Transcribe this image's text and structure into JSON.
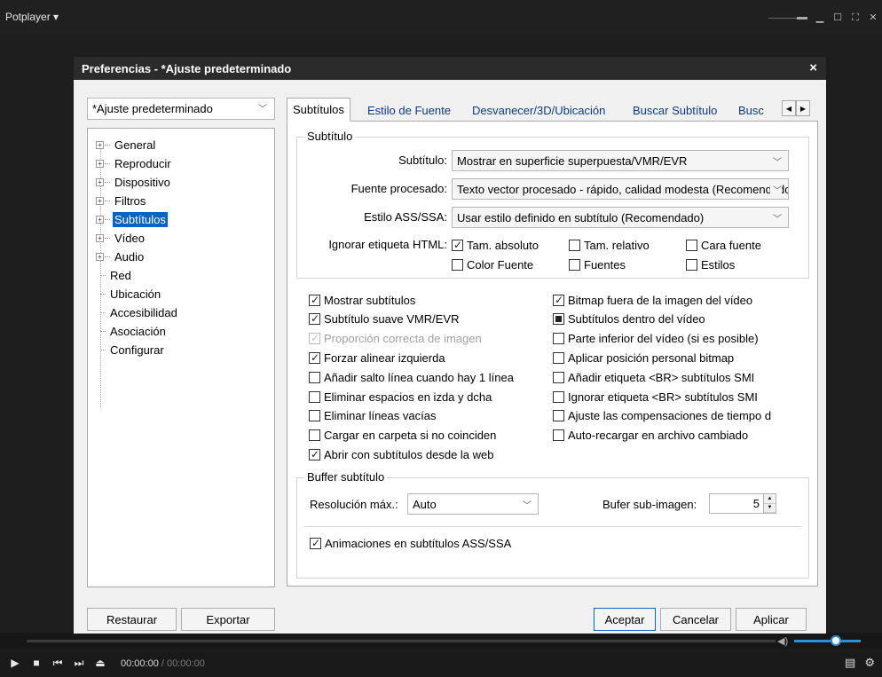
{
  "app": {
    "title": "Potplayer",
    "title_arrow": "▾"
  },
  "dialog": {
    "title": "Preferencias - *Ajuste predeterminado",
    "close": "×",
    "preset": "*Ajuste predeterminado",
    "tree": [
      {
        "label": "General",
        "expandable": true
      },
      {
        "label": "Reproducir",
        "expandable": true
      },
      {
        "label": "Dispositivo",
        "expandable": true
      },
      {
        "label": "Filtros",
        "expandable": true
      },
      {
        "label": "Subtítulos",
        "expandable": true,
        "selected": true
      },
      {
        "label": "Vídeo",
        "expandable": true
      },
      {
        "label": "Audio",
        "expandable": true
      },
      {
        "label": "Red",
        "expandable": false
      },
      {
        "label": "Ubicación",
        "expandable": false
      },
      {
        "label": "Accesibilidad",
        "expandable": false
      },
      {
        "label": "Asociación",
        "expandable": false
      },
      {
        "label": "Configurar",
        "expandable": false
      }
    ],
    "tabs": [
      {
        "label": "Subtítulos",
        "active": true
      },
      {
        "label": "Estilo de Fuente"
      },
      {
        "label": "Desvanecer/3D/Ubicación"
      },
      {
        "label": "Buscar Subtítulo"
      },
      {
        "label": "Busc"
      }
    ],
    "subtitle_group": {
      "title": "Subtítulo",
      "subtitulo_label": "Subtítulo:",
      "subtitulo_value": "Mostrar en superficie superpuesta/VMR/EVR",
      "fuente_label": "Fuente procesado:",
      "fuente_value": "Texto vector procesado - rápido, calidad modesta (Recomendado)",
      "estilo_label": "Estilo ASS/SSA:",
      "estilo_value": "Usar estilo definido en subtítulo (Recomendado)",
      "html_label": "Ignorar etiqueta HTML:",
      "html_options": [
        {
          "label": "Tam. absoluto",
          "checked": true
        },
        {
          "label": "Tam. relativo",
          "checked": false
        },
        {
          "label": "Cara fuente",
          "checked": false
        },
        {
          "label": "Color Fuente",
          "checked": false
        },
        {
          "label": "Fuentes",
          "checked": false
        },
        {
          "label": "Estilos",
          "checked": false
        }
      ]
    },
    "options_left": [
      {
        "label": "Mostrar subtítulos",
        "state": "checked"
      },
      {
        "label": "Subtítulo suave VMR/EVR",
        "state": "checked"
      },
      {
        "label": "Proporción correcta de imagen",
        "state": "disabled-checked"
      },
      {
        "label": "Forzar alinear izquierda",
        "state": "checked"
      },
      {
        "label": "Añadir salto línea cuando hay 1 línea",
        "state": "unchecked"
      },
      {
        "label": "Eliminar espacios en izda y dcha",
        "state": "unchecked"
      },
      {
        "label": "Eliminar líneas vacías",
        "state": "unchecked"
      },
      {
        "label": "Cargar en carpeta si no coinciden",
        "state": "unchecked"
      },
      {
        "label": "Abrir con subtítulos desde la web",
        "state": "checked"
      }
    ],
    "options_right": [
      {
        "label": "Bitmap fuera de la imagen del vídeo",
        "state": "checked"
      },
      {
        "label": "Subtítulos dentro del vídeo",
        "state": "filled"
      },
      {
        "label": "Parte inferior del vídeo (si es posible)",
        "state": "unchecked"
      },
      {
        "label": "Aplicar posición personal bitmap",
        "state": "unchecked"
      },
      {
        "label": "Añadir etiqueta <BR> subtítulos SMI",
        "state": "unchecked"
      },
      {
        "label": "Ignorar etiqueta <BR> subtítulos SMI",
        "state": "unchecked"
      },
      {
        "label": "Ajuste las compensaciones de tiempo d",
        "state": "unchecked"
      },
      {
        "label": "Auto-recargar en archivo cambiado",
        "state": "unchecked"
      }
    ],
    "buffer_group": {
      "title": "Buffer subtítulo",
      "resolucion_label": "Resolución máx.:",
      "resolucion_value": "Auto",
      "bufer_label": "Bufer sub-imagen:",
      "bufer_value": "5",
      "animaciones_label": "Animaciones en subtítulos ASS/SSA",
      "animaciones_checked": true
    },
    "buttons": {
      "restaurar": "Restaurar",
      "exportar": "Exportar",
      "aceptar": "Aceptar",
      "cancelar": "Cancelar",
      "aplicar": "Aplicar"
    }
  },
  "player": {
    "time_current": "00:00:00",
    "time_separator": " / ",
    "time_total": "00:00:00"
  },
  "colors": {
    "selection": "#0a64c8",
    "accent": "#2e8fd8",
    "titlebar": "#2b2b2b"
  }
}
